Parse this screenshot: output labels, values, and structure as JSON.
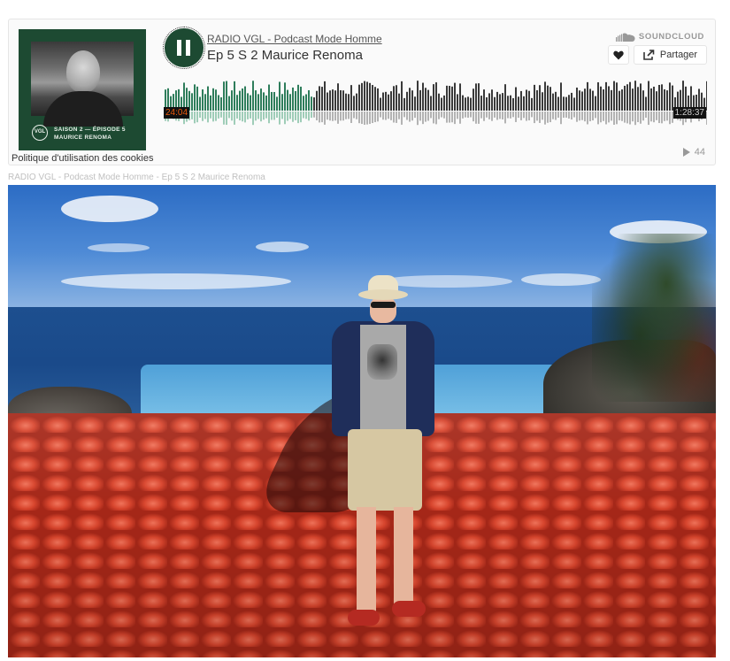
{
  "player": {
    "uploader": "RADIO VGL - Podcast Mode Homme",
    "track_title": "Ep 5 S 2 Maurice Renoma",
    "brand": "SOUNDCLOUD",
    "share_label": "Partager",
    "time_elapsed": "24:04",
    "time_total": "1:28:37",
    "progress_fraction": 0.271,
    "play_count": "44",
    "cookies_link": "Politique d'utilisation des cookies",
    "state": "playing",
    "accent_color": "#1d4a32",
    "played_wave_color": "#2e7d5b",
    "icons": {
      "play_pause": "pause-icon",
      "like": "heart-icon",
      "share": "share-icon",
      "brand": "soundcloud-icon",
      "plays": "play-count-icon"
    }
  },
  "cover": {
    "logo_text": "VGL",
    "line1": "SAISON 2 — ÉPISODE 5",
    "line2": "MAURICE RENOMA"
  },
  "caption": "RADIO VGL - Podcast Mode Homme - Ep 5 S 2 Maurice Renoma"
}
